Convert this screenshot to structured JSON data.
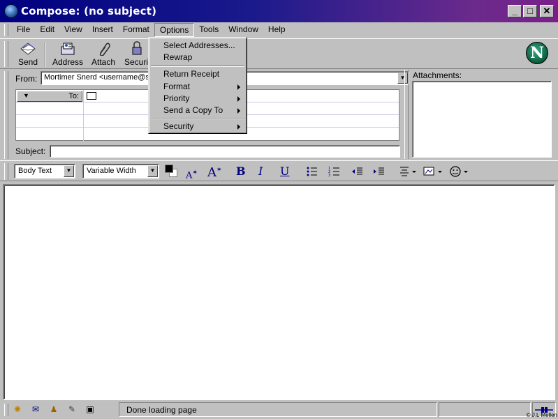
{
  "window": {
    "title": "Compose: (no subject)",
    "controls": [
      "minimize",
      "maximize",
      "close"
    ]
  },
  "menubar": {
    "items": [
      {
        "label": "File",
        "active": false
      },
      {
        "label": "Edit",
        "active": false
      },
      {
        "label": "View",
        "active": false
      },
      {
        "label": "Insert",
        "active": false
      },
      {
        "label": "Format",
        "active": false
      },
      {
        "label": "Options",
        "active": true
      },
      {
        "label": "Tools",
        "active": false
      },
      {
        "label": "Window",
        "active": false
      },
      {
        "label": "Help",
        "active": false
      }
    ]
  },
  "toolbar": {
    "send_label": "Send",
    "address_label": "Address",
    "attach_label": "Attach",
    "security_label": "Securi",
    "logo_letter": "N"
  },
  "options_menu": {
    "items": [
      {
        "label": "Select Addresses...",
        "submenu": false
      },
      {
        "label": "Rewrap",
        "submenu": false
      },
      {
        "label": "Return Receipt",
        "submenu": false
      },
      {
        "label": "Format",
        "submenu": true
      },
      {
        "label": "Priority",
        "submenu": true
      },
      {
        "label": "Send a Copy To",
        "submenu": true
      },
      {
        "label": "Security",
        "submenu": true
      }
    ]
  },
  "compose": {
    "from_label": "From:",
    "from_value": "Mortimer Snerd <username@se",
    "recipient_type": "To:",
    "subject_label": "Subject:",
    "subject_value": "",
    "attachments_label": "Attachments:"
  },
  "format_toolbar": {
    "paragraph_style": "Body Text",
    "font": "Variable Width",
    "bold_label": "B",
    "italic_label": "I",
    "underline_label": "U",
    "smaller_label": "A",
    "larger_label": "A",
    "text_color": "#000000"
  },
  "statusbar": {
    "status_text": "Done loading page",
    "copyright": "© J.L Mellen"
  }
}
